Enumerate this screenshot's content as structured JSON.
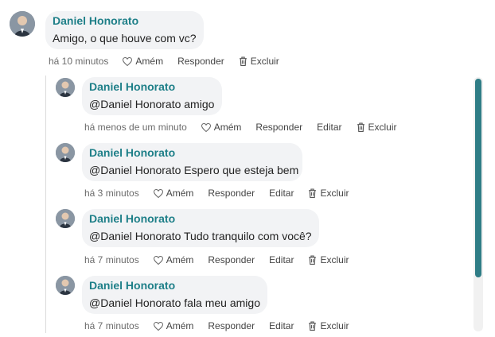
{
  "icons": {
    "heart": "heart-icon",
    "trash": "trash-icon"
  },
  "colors": {
    "author": "#1e7f88",
    "bubble": "#f2f3f5",
    "scrollbar_thumb": "#2f7d86"
  },
  "main_comment": {
    "author": "Daniel Honorato",
    "text": "Amigo, o que houve com vc?",
    "time": "há 10 minutos",
    "amen": "Amém",
    "reply": "Responder",
    "delete": "Excluir"
  },
  "replies": [
    {
      "author": "Daniel Honorato",
      "text": "@Daniel Honorato amigo",
      "time": "há menos de um minuto",
      "amen": "Amém",
      "reply": "Responder",
      "edit": "Editar",
      "delete": "Excluir"
    },
    {
      "author": "Daniel Honorato",
      "text": "@Daniel Honorato Espero que esteja bem",
      "time": "há 3 minutos",
      "amen": "Amém",
      "reply": "Responder",
      "edit": "Editar",
      "delete": "Excluir"
    },
    {
      "author": "Daniel Honorato",
      "text": "@Daniel Honorato Tudo tranquilo com você?",
      "time": "há 7 minutos",
      "amen": "Amém",
      "reply": "Responder",
      "edit": "Editar",
      "delete": "Excluir"
    },
    {
      "author": "Daniel Honorato",
      "text": "@Daniel Honorato fala meu amigo",
      "time": "há 7 minutos",
      "amen": "Amém",
      "reply": "Responder",
      "edit": "Editar",
      "delete": "Excluir"
    }
  ]
}
